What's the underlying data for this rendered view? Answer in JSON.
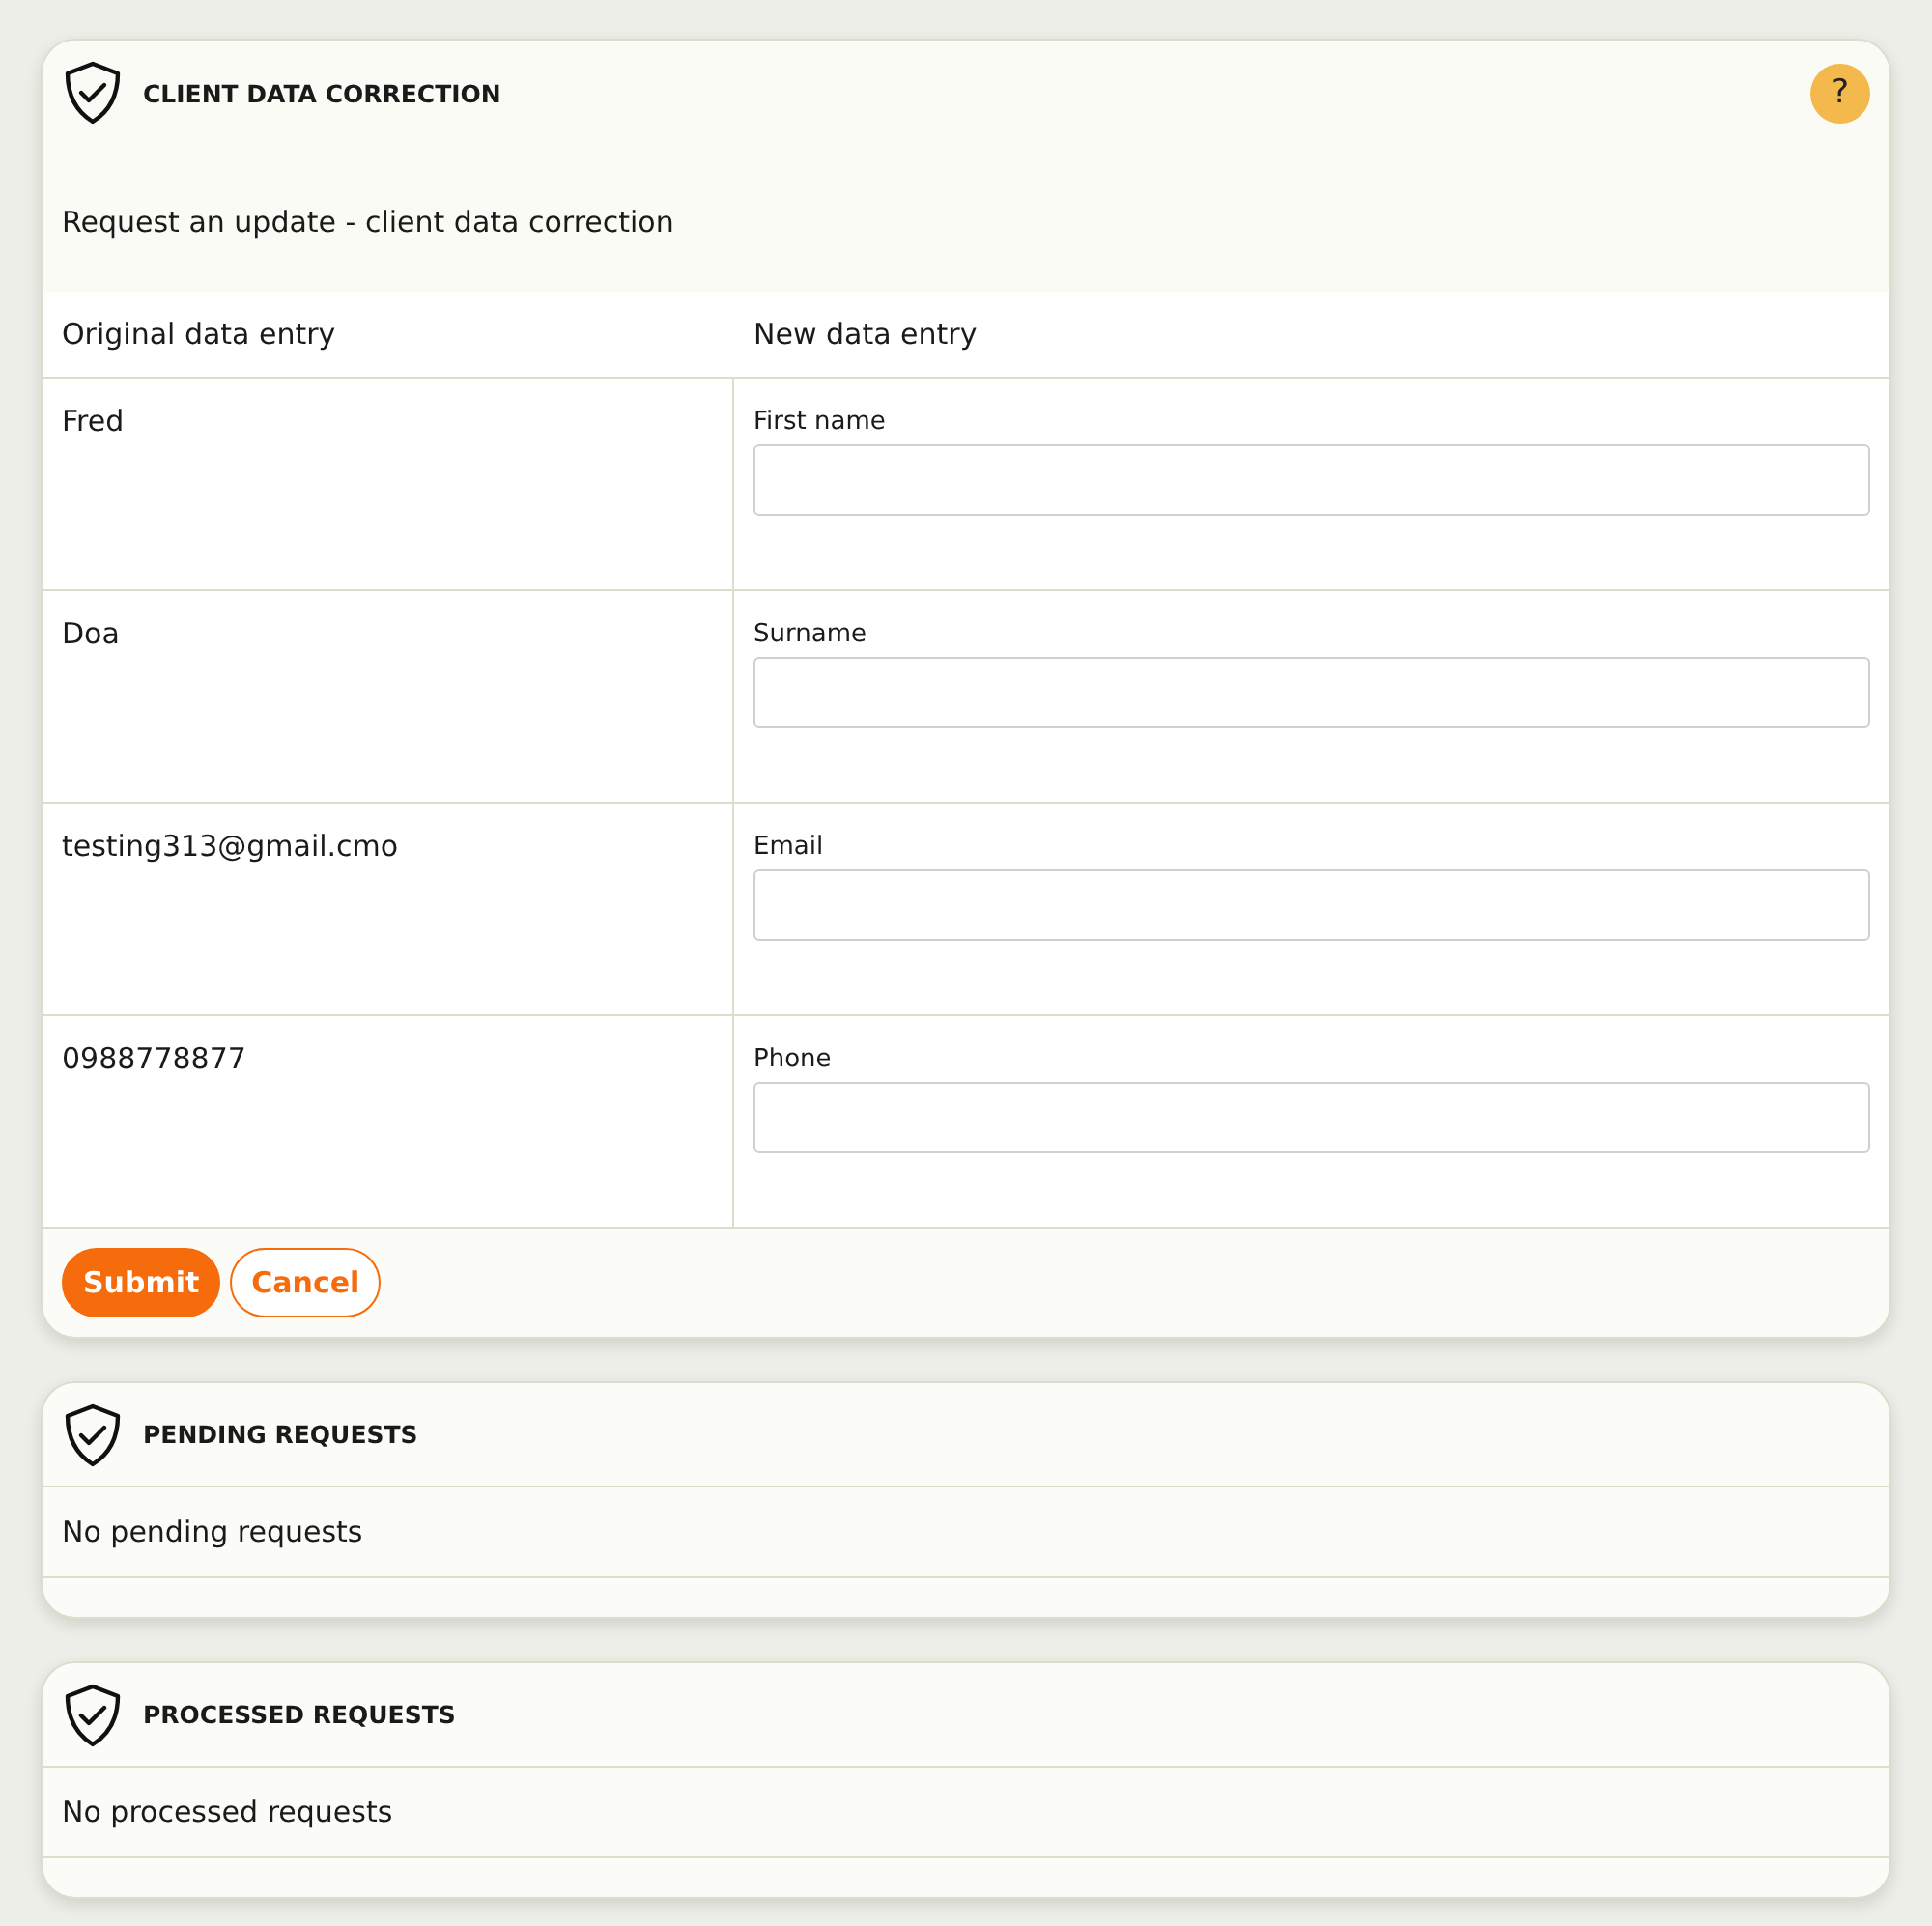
{
  "correction": {
    "title": "CLIENT DATA CORRECTION",
    "help": "?",
    "intro": "Request an update - client data correction",
    "columns": [
      "Original data entry",
      "New data entry"
    ],
    "rows": [
      {
        "original": "Fred",
        "field_label": "First name"
      },
      {
        "original": "Doa",
        "field_label": "Surname"
      },
      {
        "original": "testing313@gmail.cmo",
        "field_label": "Email"
      },
      {
        "original": "0988778877",
        "field_label": "Phone"
      }
    ],
    "buttons": [
      {
        "label": "Submit",
        "kind": "primary"
      },
      {
        "label": "Cancel",
        "kind": "secondary"
      }
    ]
  },
  "sections": [
    {
      "title": "PENDING REQUESTS",
      "message": "No pending requests"
    },
    {
      "title": "PROCESSED REQUESTS",
      "message": "No processed requests"
    }
  ]
}
